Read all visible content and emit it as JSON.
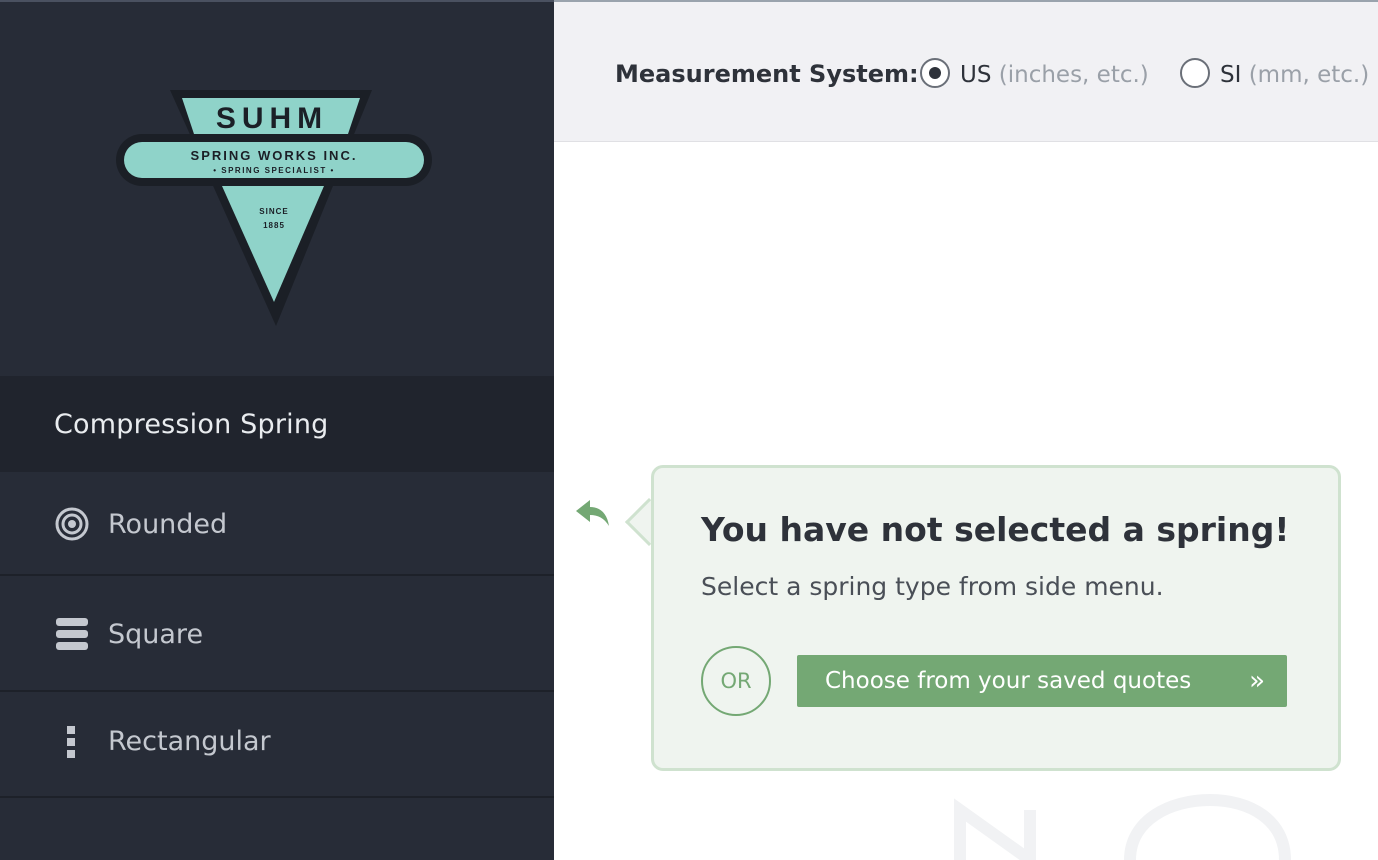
{
  "brand": {
    "name": "SUHM",
    "line1": "SPRING WORKS INC.",
    "line2": "• SPRING SPECIALIST •",
    "since": "SINCE",
    "year": "1885"
  },
  "sidebar": {
    "section_title": "Compression Spring",
    "items": [
      {
        "label": "Rounded",
        "icon": "concentric-circles-icon"
      },
      {
        "label": "Square",
        "icon": "stacked-bars-icon"
      },
      {
        "label": "Rectangular",
        "icon": "vertical-dots-icon"
      }
    ]
  },
  "measurement": {
    "label": "Measurement System:",
    "options": [
      {
        "main": "US",
        "sub": "(inches, etc.)",
        "selected": true
      },
      {
        "main": "SI",
        "sub": "(mm, etc.)",
        "selected": false
      }
    ]
  },
  "callout": {
    "title": "You have not selected a spring!",
    "message": "Select a spring type from side menu.",
    "or_label": "OR",
    "button_label": "Choose from your saved quotes",
    "button_icon": "double-chevron-right-icon"
  },
  "colors": {
    "sidebar_bg": "#272c37",
    "accent_teal": "#8fd3c9",
    "accent_green": "#74a874"
  }
}
